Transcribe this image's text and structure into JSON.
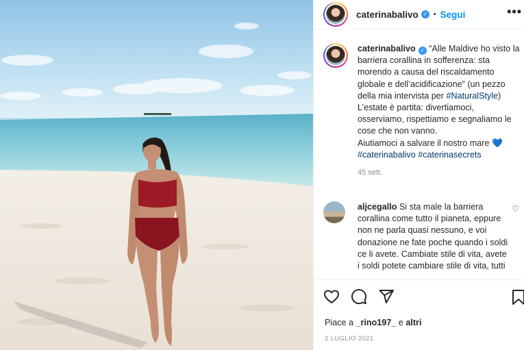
{
  "post": {
    "username": "caterinabalivo",
    "follow_label": "Segui",
    "dot": "•",
    "more_label": "•••"
  },
  "caption": {
    "username": "caterinabalivo",
    "text_before_tag": "“Alle Maldive ho visto la barriera corallina in sofferenza: sta morendo a causa del riscaldamento globale e dell’acidificazione” (un pezzo della mia intervista per ",
    "tag1": "#NaturalStyle",
    "text_after_tag": ") L’estate è partita: divertiamoci, osserviamo, rispettiamo e segnaliamo le cose che non vanno.",
    "line_last": "Aiutiamoci a salvare il nostro mare ",
    "heart": "💙",
    "tag2": "#caterinabalivo",
    "tag3": "#caterinasecrets",
    "time": "45 sett."
  },
  "comment": {
    "username": "aljcegallo",
    "text": "Si sta male la barriera corallina come tutto il pianeta, eppure non ne parla quasi nessuno, e voi donazione ne fate poche quando i soldi ce li avete. Cambiate stile di vita, avete i soldi potete cambiare stile di vita, tutti"
  },
  "actions": {
    "likes_prefix": "Piace a ",
    "likes_user": "_rino197_",
    "likes_mid": " e ",
    "likes_others": "altri",
    "date": "2 LUGLIO 2021"
  },
  "icons": {
    "like": "heart-outline",
    "comment": "speech-bubble",
    "share": "paper-plane",
    "save": "bookmark",
    "verified": "blue-check-badge",
    "comment_like": "small-heart"
  },
  "colors": {
    "link_blue": "#0095f6",
    "hashtag": "#00376b",
    "muted": "#8e8e8e",
    "verified_badge": "#3897f0"
  }
}
